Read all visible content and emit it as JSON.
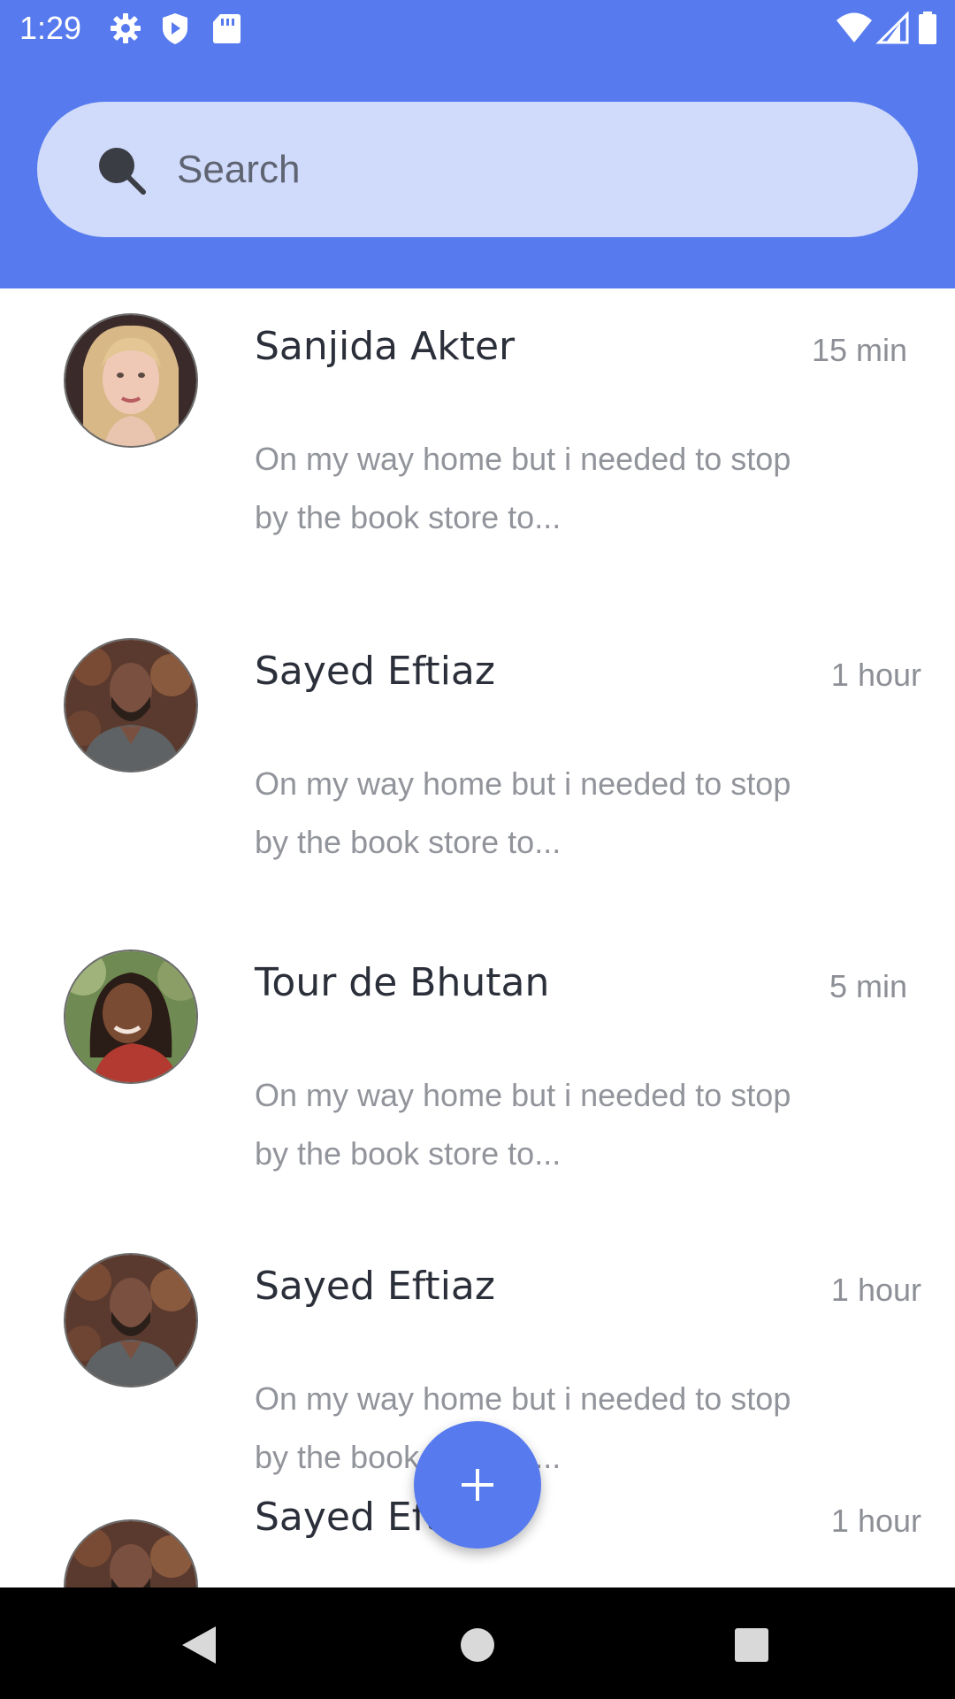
{
  "status_bar": {
    "time": "1:29",
    "icons_left": [
      "gear-icon",
      "shield-play-icon",
      "sd-card-icon"
    ],
    "icons_right": [
      "wifi-icon",
      "signal-icon",
      "battery-icon"
    ]
  },
  "search": {
    "placeholder": "Search",
    "value": ""
  },
  "conversations": [
    {
      "name": "Sanjida Akter",
      "time": "15 min",
      "preview": "On my way home but i needed to stop by the book store to...",
      "avatar": "woman-blonde-avatar"
    },
    {
      "name": "Sayed Eftiaz",
      "time": "1 hour",
      "preview": "On my way home but i needed to stop by the book store to...",
      "avatar": "man-beard-avatar"
    },
    {
      "name": "Tour de Bhutan",
      "time": "5 min",
      "preview": "On my way home but i needed to stop by the book store to...",
      "avatar": "woman-red-avatar"
    },
    {
      "name": "Sayed Eftiaz",
      "time": "1 hour",
      "preview": "On my way home but i needed to stop by the book store to...",
      "avatar": "man-beard-avatar"
    },
    {
      "name": "Sayed Eftiaz",
      "time": "1 hour",
      "preview": "",
      "avatar": "man-beard-avatar"
    }
  ],
  "fab": {
    "icon": "plus-icon"
  },
  "nav_bar": {
    "buttons": [
      "back-icon",
      "home-icon",
      "recents-icon"
    ]
  },
  "colors": {
    "primary": "#577bee",
    "search_background": "#d0dbfb",
    "name_text": "#2b2f3a",
    "secondary_text": "#8d8f96",
    "nav_background": "#000000"
  }
}
